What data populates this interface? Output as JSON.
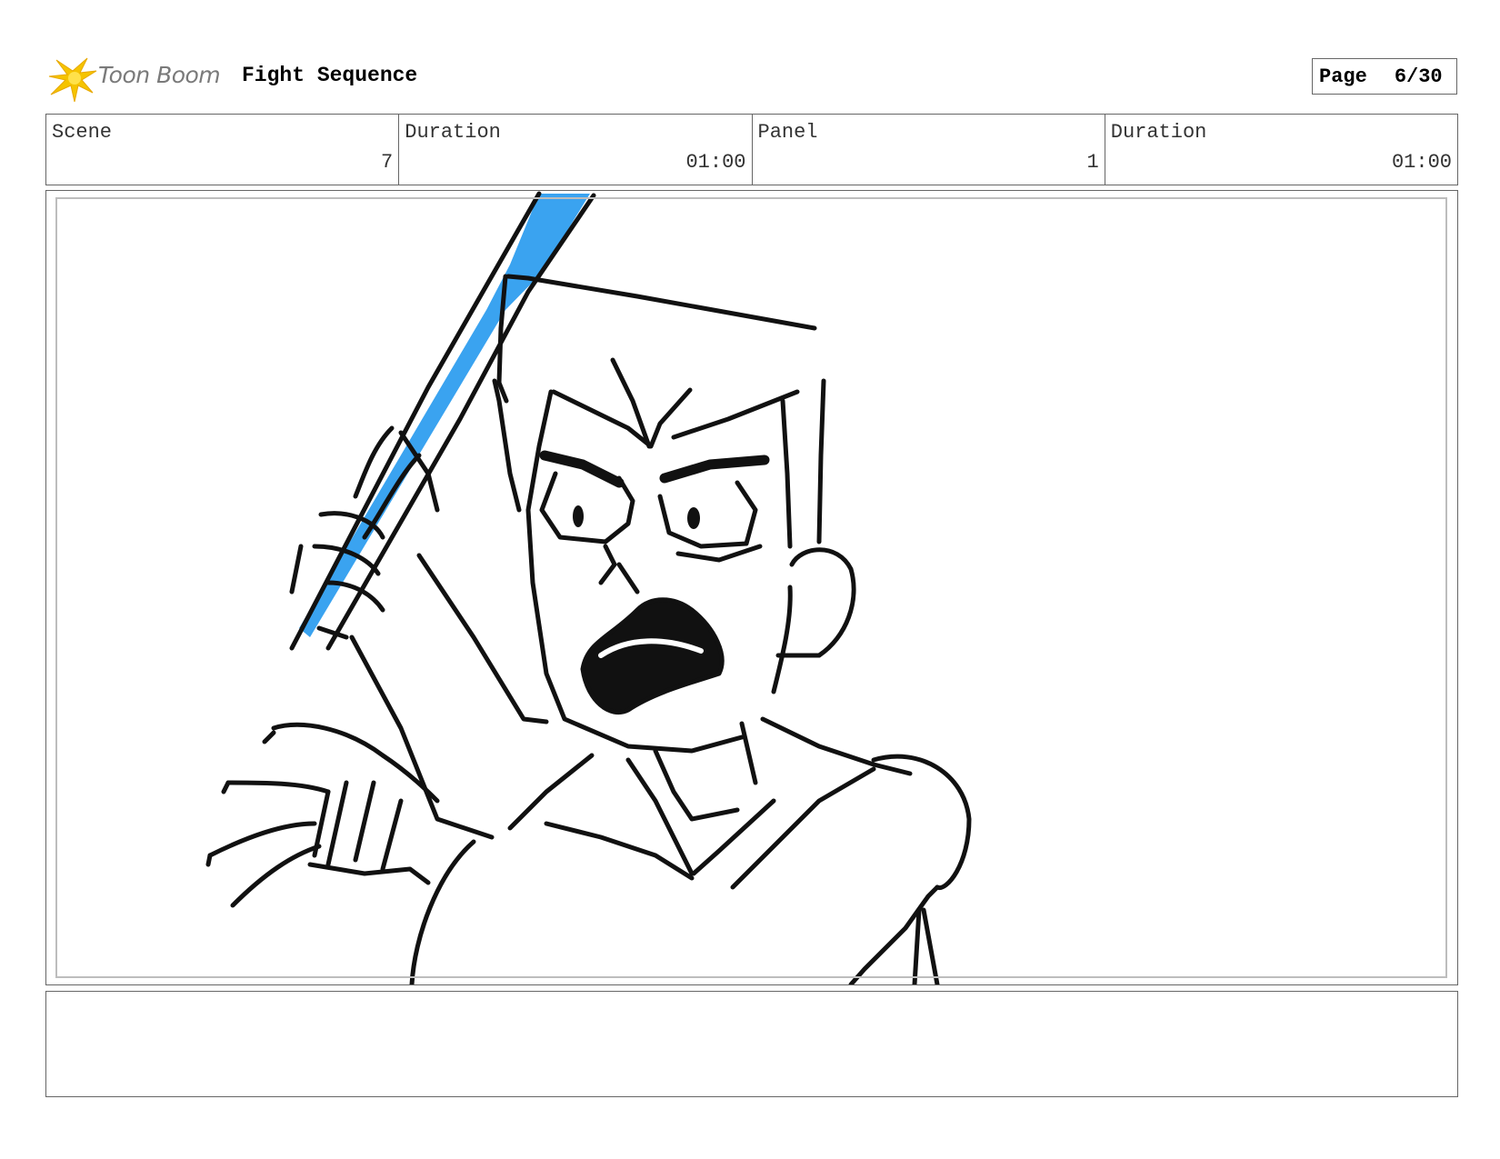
{
  "header": {
    "logo_text": "Toon Boom",
    "title": "Fight Sequence",
    "page_label": "Page",
    "page_number": "6/30"
  },
  "info": {
    "scene_label": "Scene",
    "scene_value": "7",
    "scene_duration_label": "Duration",
    "scene_duration_value": "01:00",
    "panel_label": "Panel",
    "panel_value": "1",
    "panel_duration_label": "Duration",
    "panel_duration_value": "01:00"
  },
  "panel": {
    "sketch_icon": "character-with-sword-sketch",
    "accent_color": "#3aa3f0",
    "line_color": "#111111"
  },
  "notes": {
    "text": ""
  },
  "colors": {
    "logo_star": "#f5c400",
    "border": "#666666",
    "inner_border": "#bdbdbd"
  }
}
